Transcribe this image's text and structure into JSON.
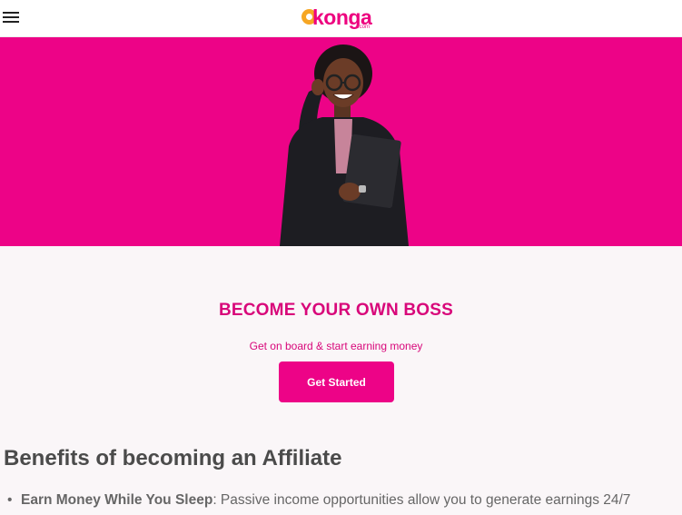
{
  "header": {
    "menu_icon": "hamburger-icon",
    "logo_text": "konga",
    "logo_sub": ".com"
  },
  "hero": {
    "background_color": "#ed0387"
  },
  "cta": {
    "title": "BECOME YOUR OWN BOSS",
    "subtitle": "Get on board & start earning money",
    "button_label": "Get Started",
    "accent_color": "#ed0387"
  },
  "benefits": {
    "title": "Benefits of becoming an Affiliate",
    "items": [
      {
        "bold": "Earn Money While You Sleep",
        "text": ": Passive income opportunities allow you to generate earnings 24/7"
      }
    ]
  }
}
